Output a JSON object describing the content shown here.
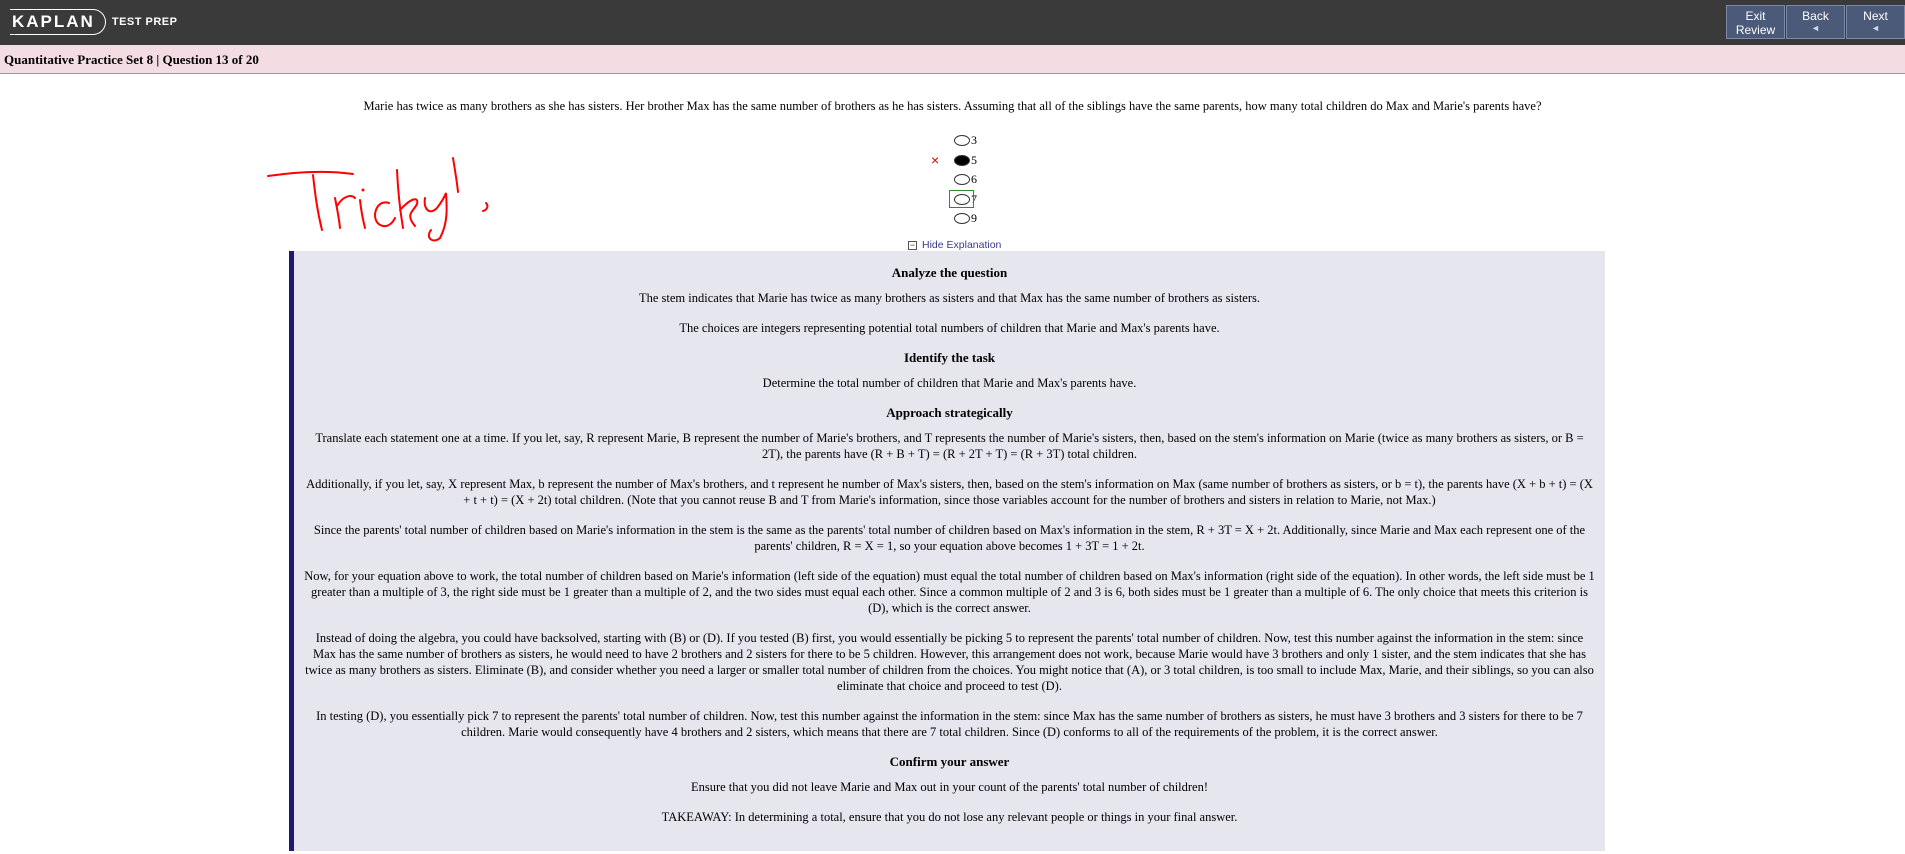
{
  "header": {
    "brand": "KAPLAN",
    "brand_sub": "TEST PREP",
    "buttons": [
      {
        "label": "Exit",
        "label2": "Review"
      },
      {
        "label": "Back",
        "arrow": "◄"
      },
      {
        "label": "Next",
        "arrow": "◄"
      }
    ]
  },
  "subheader": {
    "title": "Quantitative Practice Set 8 | Question 13 of 20"
  },
  "question": {
    "text": "Marie has twice as many brothers as she has sisters. Her brother Max has the same number of brothers as he has sisters. Assuming that all of the siblings have the same parents, how many total children do Max and Marie's parents have?",
    "choices": [
      "3",
      "5",
      "6",
      "7",
      "9"
    ],
    "selected_index": 1,
    "correct_index": 3,
    "wrong_mark": "×"
  },
  "annotation": "Tricky!",
  "explanation_toggle": "Hide Explanation",
  "explanation": {
    "h_analyze": "Analyze the question",
    "p1": "The stem indicates that Marie has twice as many brothers as sisters and that Max has the same number of brothers as sisters.",
    "p2": "The choices are integers representing potential total numbers of children that Marie and Max's parents have.",
    "h_task": "Identify the task",
    "p3": "Determine the total number of children that Marie and Max's parents have.",
    "h_approach": "Approach strategically",
    "p4": "Translate each statement one at a time. If you let, say, R represent Marie, B represent the number of Marie's brothers, and T represents the number of Marie's sisters, then, based on the stem's information on Marie (twice as many brothers as sisters, or B = 2T), the parents have (R + B + T) = (R + 2T + T) = (R + 3T) total children.",
    "p5": "Additionally, if you let, say, X represent Max, b represent the number of Max's brothers, and t represent he number of Max's sisters, then, based on the stem's information on Max (same number of brothers as sisters, or b = t), the parents have (X + b + t) = (X + t + t) = (X + 2t) total children. (Note that you cannot reuse B and T from Marie's information, since those variables account for the number of brothers and sisters in relation to Marie, not Max.)",
    "p6": "Since the parents' total number of children based on Marie's information in the stem is the same as the parents' total number of children based on Max's information in the stem, R + 3T = X + 2t. Additionally, since Marie and Max each represent one of the parents' children, R = X = 1, so your equation above becomes 1 + 3T = 1 + 2t.",
    "p7": "Now, for your equation above to work, the total number of children based on Marie's information (left side of the equation) must equal the total number of children based on Max's information (right side of the equation). In other words, the left side must be 1 greater than a multiple of 3, the right side must be 1 greater than a multiple of 2, and the two sides must equal each other. Since a common multiple of 2 and 3 is 6, both sides must be 1 greater than a multiple of 6. The only choice that meets this criterion is (D), which is the correct answer.",
    "p8": "Instead of doing the algebra, you could have backsolved, starting with (B) or (D). If you tested (B) first, you would essentially be picking 5 to represent the parents' total number of children. Now, test this number against the information in the stem: since Max has the same number of brothers as sisters, he would need to have 2 brothers and 2 sisters for there to be 5 children. However, this arrangement does not work, because Marie would have 3 brothers and only 1 sister, and the stem indicates that she has twice as many brothers as sisters. Eliminate (B), and consider whether you need a larger or smaller total number of children from the choices. You might notice that (A), or 3 total children, is too small to include Max, Marie, and their siblings, so you can also eliminate that choice and proceed to test (D).",
    "p9": "In testing (D), you essentially pick 7 to represent the parents' total number of children. Now, test this number against the information in the stem: since Max has the same number of brothers as sisters, he must have 3 brothers and 3 sisters for there to be 7 children. Marie would consequently have 4 brothers and 2 sisters, which means that there are 7 total children. Since (D) conforms to all of the requirements of the problem, it is the correct answer.",
    "h_confirm": "Confirm your answer",
    "p10": "Ensure that you did not leave Marie and Max out in your count of the parents' total number of children!",
    "p11": "TAKEAWAY: In determining a total, ensure that you do not lose any relevant people or things in your final answer."
  }
}
